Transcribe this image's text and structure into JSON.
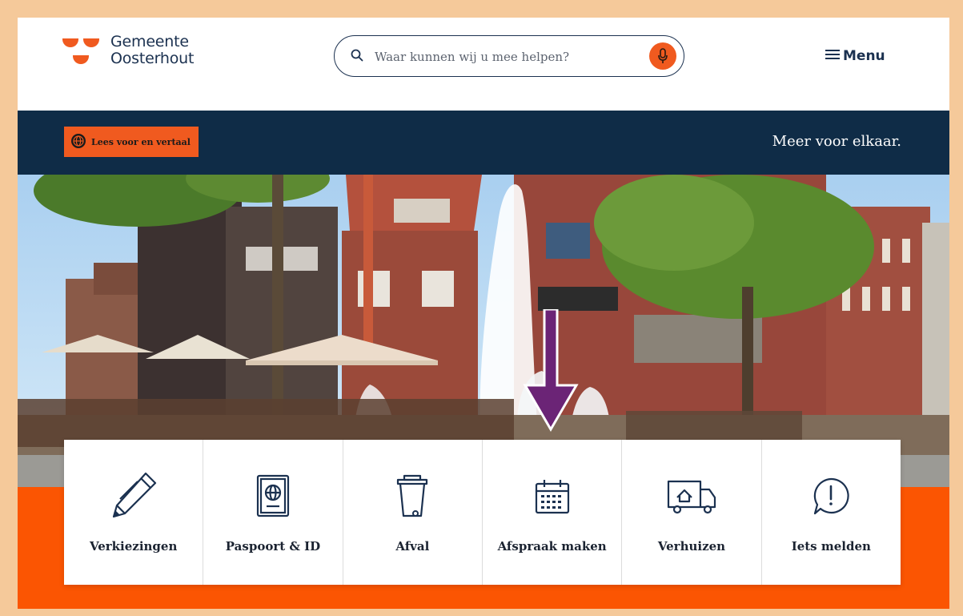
{
  "header": {
    "logo": {
      "line1": "Gemeente",
      "line2": "Oosterhout",
      "icon": "gemeente-logo-icon"
    },
    "search": {
      "placeholder": "Waar kunnen wij u mee helpen?",
      "icon": "search-icon",
      "voice_icon": "microphone-icon"
    },
    "menu": {
      "label": "Menu",
      "icon": "hamburger-icon"
    }
  },
  "banner": {
    "translate_button": "Lees voor en vertaal",
    "tagline": "Meer voor elkaar."
  },
  "tiles": [
    {
      "label": "Verkiezingen",
      "icon": "pencil-icon"
    },
    {
      "label": "Paspoort & ID",
      "icon": "passport-icon"
    },
    {
      "label": "Afval",
      "icon": "trash-bin-icon"
    },
    {
      "label": "Afspraak maken",
      "icon": "calendar-icon"
    },
    {
      "label": "Verhuizen",
      "icon": "moving-truck-icon"
    },
    {
      "label": "Iets melden",
      "icon": "alert-bubble-icon"
    }
  ],
  "colors": {
    "brand_orange": "#f05a1f",
    "navy": "#0f2c47",
    "annotation_arrow": "#6b2476",
    "border_frame": "#f5c99a"
  }
}
